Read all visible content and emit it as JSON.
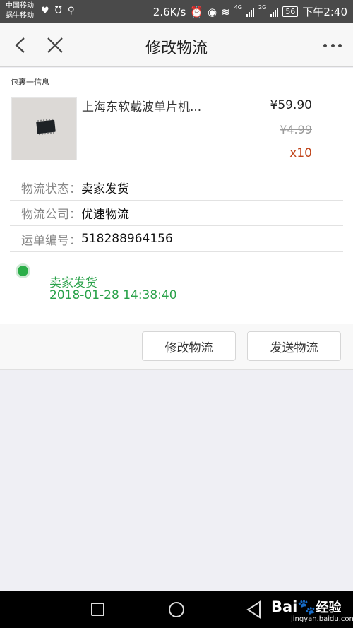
{
  "status_bar": {
    "carrier_1": "中国移动",
    "carrier_2": "蜗牛移动",
    "speed": "2.6K/s",
    "network_1": "4G",
    "network_2": "2G",
    "battery": "56",
    "time": "下午2:40"
  },
  "header": {
    "title": "修改物流"
  },
  "package": {
    "section_label": "包裹一信息",
    "product_name": "上海东软载波单片机...",
    "price": "¥59.90",
    "original_price": "¥4.99",
    "quantity": "x10"
  },
  "logistics": {
    "status_label": "物流状态：",
    "status_value": "卖家发货",
    "company_label": "物流公司：",
    "company_value": "优速物流",
    "tracking_label": "运单编号：",
    "tracking_value": "518288964156"
  },
  "timeline": {
    "status": "卖家发货",
    "time": "2018-01-28 14:38:40"
  },
  "actions": {
    "modify_label": "修改物流",
    "send_label": "发送物流"
  },
  "watermark": {
    "brand": "Bai",
    "brand_cn": "经验",
    "url": "jingyan.baidu.com"
  },
  "colors": {
    "accent_green": "#2aae48",
    "quantity_orange": "#c0441a"
  }
}
